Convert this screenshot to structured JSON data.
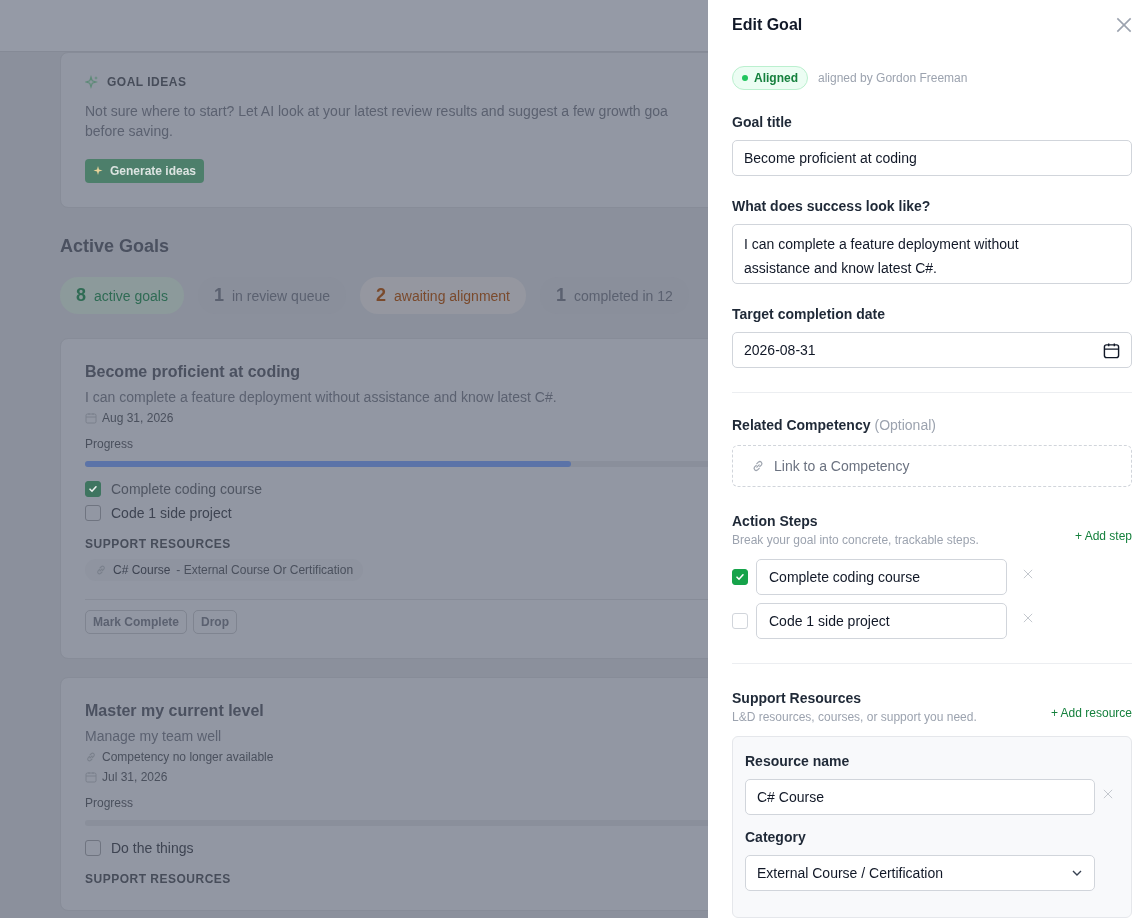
{
  "page": {
    "goal_ideas": {
      "heading": "GOAL IDEAS",
      "lines": [
        "Not sure where to start? Let AI look at your latest review results and suggest a few growth goa",
        "before saving."
      ],
      "button": "Generate ideas"
    },
    "section_title": "Active Goals",
    "stats": [
      {
        "count": "8",
        "label": "active goals",
        "color": "#2f6b54"
      },
      {
        "count": "1",
        "label": "in review queue",
        "color": "#5b6170"
      },
      {
        "count": "2",
        "label": "awaiting alignment",
        "color": "#7a4a2c"
      },
      {
        "count": "1",
        "label": "completed in 12",
        "color": "#5b6170"
      }
    ],
    "goals": [
      {
        "title": "Become proficient at coding",
        "description": "I can complete a feature deployment without assistance and know latest C#.",
        "date": "Aug 31, 2026",
        "progress_label": "Progress",
        "level": 0.5,
        "steps": [
          {
            "text": "Complete coding course",
            "checked": true
          },
          {
            "text": "Code 1 side project",
            "checked": false
          }
        ],
        "resources_heading": "SUPPORT RESOURCES",
        "resources": [
          {
            "name": "C# Course",
            "category": "- External Course Or Certification"
          }
        ],
        "actions": [
          "Mark Complete",
          "Drop"
        ]
      },
      {
        "title": "Master my current level",
        "description": "Manage my team well",
        "competency": "Competency no longer available",
        "date": "Jul 31, 2026",
        "progress_label": "Progress",
        "level": 0,
        "steps": [
          {
            "text": "Do the things",
            "checked": false
          }
        ],
        "resources_heading": "SUPPORT RESOURCES"
      }
    ]
  },
  "drawer": {
    "title": "Edit Goal",
    "status": {
      "label": "Aligned",
      "note": "aligned by Gordon Freeman"
    },
    "title_field": {
      "label": "Goal title",
      "value": "Become proficient at coding"
    },
    "success_field": {
      "label": "What does success look like?",
      "value": "I can complete a feature deployment without assistance and know latest C#."
    },
    "date_field": {
      "label": "Target completion date",
      "value": "2026-08-31"
    },
    "competency": {
      "label": "Related Competency",
      "optional": "(Optional)",
      "button": "Link to a Competency"
    },
    "steps": {
      "heading": "Action Steps",
      "hint": "Break your goal into concrete, trackable steps.",
      "add": "+ Add step",
      "items": [
        {
          "text": "Complete coding course",
          "checked": true
        },
        {
          "text": "Code 1 side project",
          "checked": false
        }
      ]
    },
    "resources": {
      "heading": "Support Resources",
      "hint": "L&D resources, courses, or support you need.",
      "add": "+ Add resource",
      "items": [
        {
          "name_label": "Resource name",
          "name": "C# Course",
          "category_label": "Category",
          "category": "External Course / Certification"
        }
      ]
    }
  }
}
